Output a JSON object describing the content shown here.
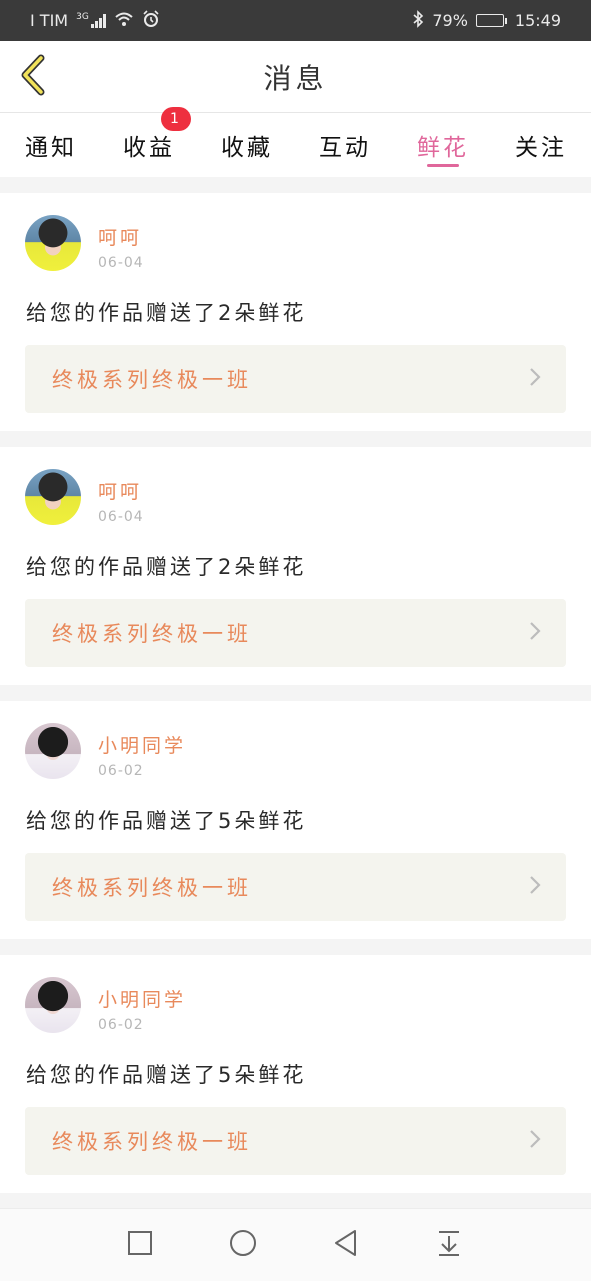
{
  "status_bar": {
    "carrier": "I TIM",
    "network": "3G",
    "battery": "79%",
    "battery_level": 0.79,
    "time": "15:49",
    "icons": [
      "signal-icon",
      "wifi-icon",
      "alarm-icon",
      "bluetooth-icon",
      "battery-icon"
    ]
  },
  "header": {
    "title": "消息",
    "back_icon": "chevron-left-icon"
  },
  "tabs": [
    {
      "label": "通知"
    },
    {
      "label": "收益",
      "badge": "1"
    },
    {
      "label": "收藏"
    },
    {
      "label": "互动"
    },
    {
      "label": "鲜花",
      "active": true
    },
    {
      "label": "关注"
    }
  ],
  "feed": [
    {
      "username": "呵呵",
      "date": "06-04",
      "message": "给您的作品赠送了2朵鲜花",
      "work_title": "终极系列终极一班"
    },
    {
      "username": "呵呵",
      "date": "06-04",
      "message": "给您的作品赠送了2朵鲜花",
      "work_title": "终极系列终极一班"
    },
    {
      "username": "小明同学",
      "date": "06-02",
      "message": "给您的作品赠送了5朵鲜花",
      "work_title": "终极系列终极一班"
    },
    {
      "username": "小明同学",
      "date": "06-02",
      "message": "给您的作品赠送了5朵鲜花",
      "work_title": "终极系列终极一班"
    }
  ],
  "colors": {
    "accent": "#e0679b",
    "username": "#e8895b",
    "badge": "#ee2f3f",
    "back_arrow": "#f1e25a"
  },
  "nav_bar": {
    "icons": [
      "square-icon",
      "circle-icon",
      "triangle-back-icon",
      "notification-pull-icon"
    ]
  }
}
